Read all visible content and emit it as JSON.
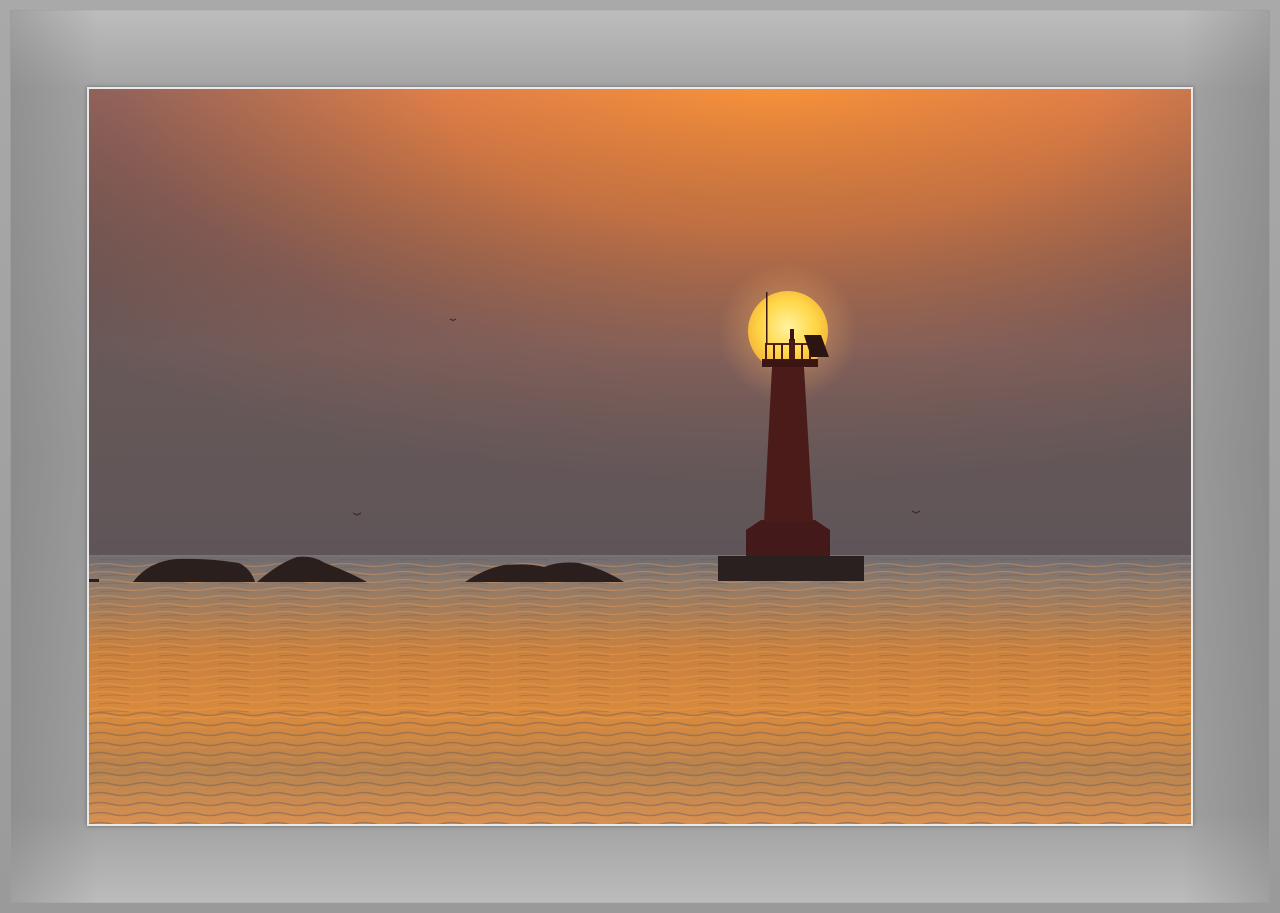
{
  "image": {
    "subject": "lighthouse-silhouette",
    "colors": {
      "sky_top": "#f38a3c",
      "sky_mid": "#9a6350",
      "sky_horizon": "#665754",
      "sun": "#ffd94a",
      "sea_near": "#d0813e",
      "sea_far": "#6f6a6c",
      "silhouette": "#2a1512",
      "frame": "#9d9d9d"
    }
  }
}
